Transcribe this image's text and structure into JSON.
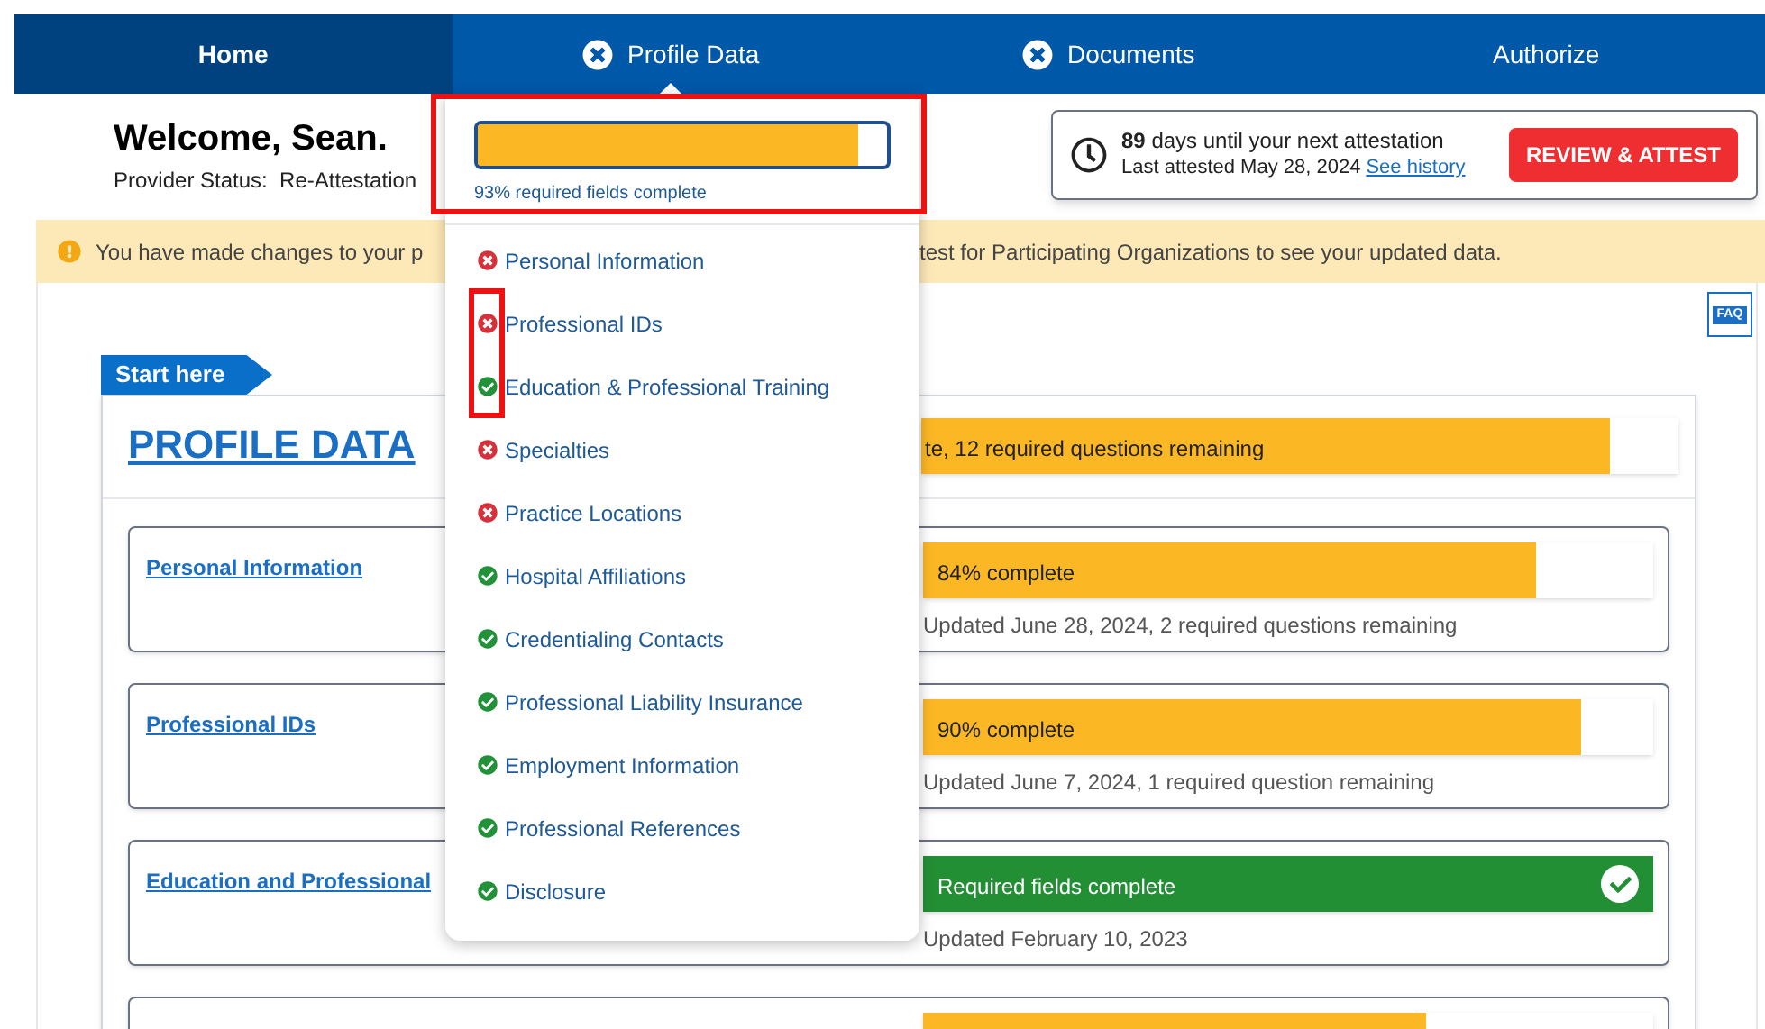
{
  "nav": {
    "tabs": [
      {
        "label": "Home",
        "selected": true,
        "incomplete": false,
        "expanded": false
      },
      {
        "label": "Profile Data",
        "selected": false,
        "incomplete": true,
        "expanded": true
      },
      {
        "label": "Documents",
        "selected": false,
        "incomplete": true,
        "expanded": false
      },
      {
        "label": "Authorize",
        "selected": false,
        "incomplete": false,
        "expanded": false
      }
    ]
  },
  "welcome": {
    "title": "Welcome, Sean.",
    "status": "Provider Status:  Re-Attestation"
  },
  "attestation": {
    "days": "**89** days until your next attestation",
    "last_attested": "Last attested May 28, 2024",
    "history_link": "See history",
    "button": "REVIEW & ATTEST"
  },
  "banner": {
    "text_left": "You have made changes to your p",
    "text_right": "test for Participating Organizations to see your updated data."
  },
  "faq": {
    "label": "FAQ"
  },
  "profile": {
    "tag": "Start here",
    "title": "PROFILE DATA",
    "overall": {
      "level": 0.91,
      "text": "te, 12 required questions remaining"
    },
    "sections": [
      {
        "title": "Personal Information",
        "complete": false,
        "level": 0.84,
        "bar_text": "84% complete",
        "updated": "Updated June 28, 2024, 2 required questions remaining"
      },
      {
        "title": "Professional IDs",
        "complete": false,
        "level": 0.9,
        "bar_text": "90% complete",
        "updated": "Updated June 7, 2024, 1 required question remaining"
      },
      {
        "title": "Education and Professional",
        "complete": true,
        "level": 1,
        "bar_text": "Required fields complete",
        "updated": "Updated February 10, 2023"
      },
      {
        "complete": false,
        "level": 0.69
      }
    ]
  },
  "dropdown": {
    "progress": {
      "level": 0.93,
      "label": "93% required fields complete"
    },
    "items": [
      {
        "label": "Personal Information",
        "complete": false
      },
      {
        "label": "Professional IDs",
        "complete": false
      },
      {
        "label": "Education & Professional Training",
        "complete": true
      },
      {
        "label": "Specialties",
        "complete": false
      },
      {
        "label": "Practice Locations",
        "complete": false
      },
      {
        "label": "Hospital Affiliations",
        "complete": true
      },
      {
        "label": "Credentialing Contacts",
        "complete": true
      },
      {
        "label": "Professional Liability Insurance",
        "complete": true
      },
      {
        "label": "Employment Information",
        "complete": true
      },
      {
        "label": "Professional References",
        "complete": true
      },
      {
        "label": "Disclosure",
        "complete": true
      }
    ]
  }
}
